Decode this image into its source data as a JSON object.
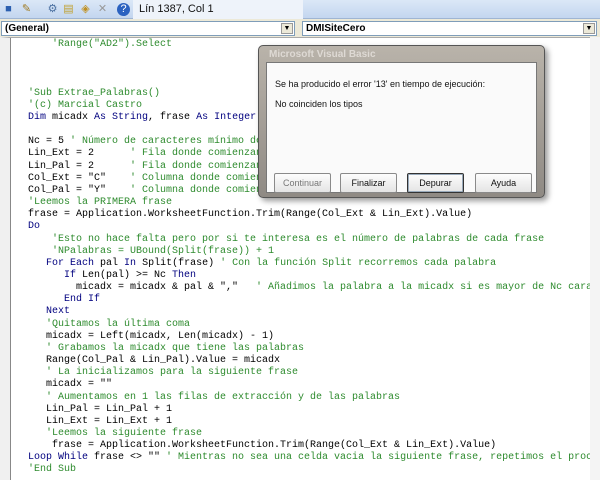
{
  "toolbar": {
    "position": "Lín 1387, Col 1",
    "icons": [
      "stop-icon",
      "design-mode-icon",
      "project-explorer-icon",
      "properties-icon",
      "object-browser-icon",
      "toolbox-icon",
      "help-icon"
    ]
  },
  "combos": {
    "object": "(General)",
    "procedure": "DMISiteCero"
  },
  "code": [
    [
      [
        "    'Range(\"AD2\").Select",
        "c"
      ]
    ],
    [],
    [],
    [],
    [
      [
        "'Sub Extrae_Palabras()",
        "c"
      ]
    ],
    [
      [
        "'(c) Marcial Castro",
        "c"
      ]
    ],
    [
      [
        "Dim",
        "k"
      ],
      [
        " micadx ",
        "n"
      ],
      [
        "As String",
        "k"
      ],
      [
        ", frase ",
        "n"
      ],
      [
        "As Integer",
        "k"
      ]
    ],
    [],
    [
      [
        "Nc = 5 ",
        "n"
      ],
      [
        "' Número de caracteres mínimo de",
        "c"
      ]
    ],
    [
      [
        "Lin_Ext = 2      ",
        "n"
      ],
      [
        "' Fila donde comienzan l",
        "c"
      ]
    ],
    [
      [
        "Lin_Pal = 2      ",
        "n"
      ],
      [
        "' Fila donde comienzan l",
        "c"
      ]
    ],
    [
      [
        "Col_Ext = \"C\"    ",
        "n"
      ],
      [
        "' Columna donde comienza",
        "c"
      ]
    ],
    [
      [
        "Col_Pal = \"Y\"    ",
        "n"
      ],
      [
        "' Columna donde comienza",
        "c"
      ]
    ],
    [
      [
        "'Leemos la PRIMERA frase",
        "c"
      ]
    ],
    [
      [
        "frase = Application.WorksheetFunction.Trim(Range(Col_Ext & Lin_Ext).Value)",
        "n"
      ]
    ],
    [
      [
        "Do",
        "k"
      ]
    ],
    [
      [
        "    'Esto no hace falta pero por si te interesa es el número de palabras de cada frase",
        "c"
      ]
    ],
    [
      [
        "    'NPalabras = UBound(Split(frase)) + 1",
        "c"
      ]
    ],
    [
      [
        "   ",
        "n"
      ],
      [
        "For Each",
        "k"
      ],
      [
        " pal ",
        "n"
      ],
      [
        "In",
        "k"
      ],
      [
        " Split(frase) ",
        "n"
      ],
      [
        "' Con la función Split recorremos cada palabra",
        "c"
      ]
    ],
    [
      [
        "      ",
        "n"
      ],
      [
        "If",
        "k"
      ],
      [
        " Len(pal) >= Nc ",
        "n"
      ],
      [
        "Then",
        "k"
      ]
    ],
    [
      [
        "        micadx = micadx & pal & \",\"   ",
        "n"
      ],
      [
        "' Añadimos la palabra a la micadx si es mayor de Nc carac",
        "c"
      ]
    ],
    [
      [
        "      ",
        "n"
      ],
      [
        "End If",
        "k"
      ]
    ],
    [
      [
        "   ",
        "n"
      ],
      [
        "Next",
        "k"
      ]
    ],
    [
      [
        "   'Quitamos la última coma",
        "c"
      ]
    ],
    [
      [
        "   micadx = Left(micadx, Len(micadx) - 1)",
        "n"
      ]
    ],
    [
      [
        "   ' Grabamos la micadx que tiene las palabras",
        "c"
      ]
    ],
    [
      [
        "   Range(Col_Pal & Lin_Pal).Value = micadx",
        "n"
      ]
    ],
    [
      [
        "   ' La inicializamos para la siguiente frase",
        "c"
      ]
    ],
    [
      [
        "   micadx = \"\"",
        "n"
      ]
    ],
    [
      [
        "   ' Aumentamos en 1 las filas de extracción y de las palabras",
        "c"
      ]
    ],
    [
      [
        "   Lin_Pal = Lin_Pal + 1",
        "n"
      ]
    ],
    [
      [
        "   Lin_Ext = Lin_Ext + 1",
        "n"
      ]
    ],
    [
      [
        "   'Leemos la siguiente frase",
        "c"
      ]
    ],
    [
      [
        "    frase = Application.WorksheetFunction.Trim(Range(Col_Ext & Lin_Ext).Value)",
        "n"
      ]
    ],
    [
      [
        "Loop While",
        "k"
      ],
      [
        " frase <> \"\" ",
        "n"
      ],
      [
        "' Mientras no sea una celda vacia la siguiente frase, repetimos el proce",
        "c"
      ]
    ],
    [
      [
        "'End Sub",
        "c"
      ]
    ]
  ],
  "dialog": {
    "title": "Microsoft Visual Basic",
    "message": "Se ha producido el error '13' en tiempo de ejecución:",
    "detail": "No coinciden los tipos",
    "buttons": {
      "continue": "Continuar",
      "end": "Finalizar",
      "debug": "Depurar",
      "help": "Ayuda"
    }
  }
}
